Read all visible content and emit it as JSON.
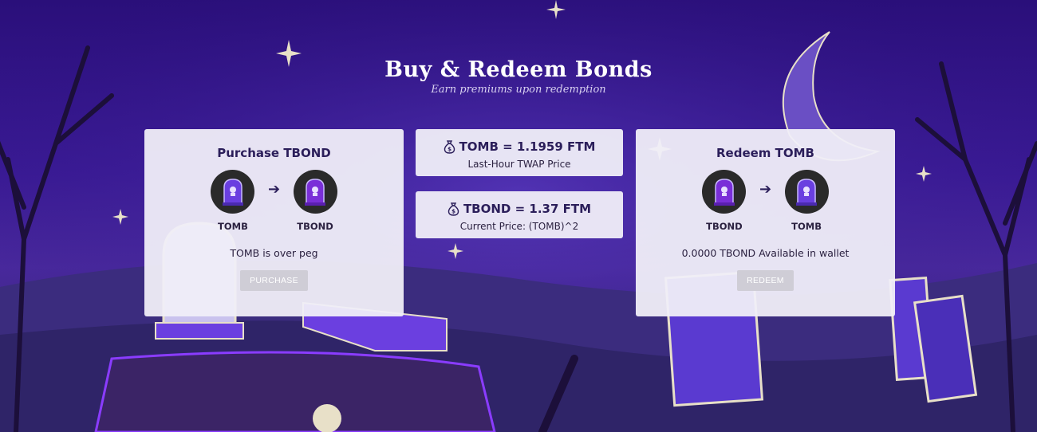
{
  "hero": {
    "title": "Buy & Redeem Bonds",
    "subtitle": "Earn premiums upon redemption"
  },
  "purchase_card": {
    "title": "Purchase TBOND",
    "from_token": "TOMB",
    "to_token": "TBOND",
    "message": "TOMB is over peg",
    "button_label": "PURCHASE"
  },
  "tomb_price_card": {
    "value": "TOMB = 1.1959 FTM",
    "caption": "Last-Hour TWAP Price"
  },
  "tbond_price_card": {
    "value": "TBOND = 1.37 FTM",
    "caption": "Current Price: (TOMB)^2"
  },
  "redeem_card": {
    "title": "Redeem TOMB",
    "from_token": "TBOND",
    "to_token": "TOMB",
    "message": "0.0000 TBOND Available in wallet",
    "button_label": "REDEEM"
  },
  "colors": {
    "accent": "#2b1e5a",
    "card_bg": "#f0eef8",
    "button_disabled": "#cfcdd6",
    "background": "#3a1a95"
  },
  "icons": [
    "money-bag-icon",
    "tombstone-icon",
    "arrow-right-icon",
    "star-icon",
    "moon-icon"
  ]
}
